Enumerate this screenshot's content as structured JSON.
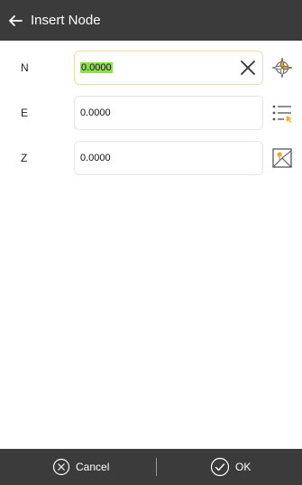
{
  "header": {
    "title": "Insert Node",
    "back_icon": "arrow-left-icon"
  },
  "fields": [
    {
      "label": "N",
      "value": "0.0000",
      "side_icon": "compass-target-icon"
    },
    {
      "label": "E",
      "value": "0.0000",
      "side_icon": "point-list-icon"
    },
    {
      "label": "Z",
      "value": "0.0000",
      "side_icon": "map-pick-icon"
    }
  ],
  "footer": {
    "cancel_label": "Cancel",
    "ok_label": "OK"
  },
  "colors": {
    "header_bg": "#3b3b3b",
    "selection_highlight": "#8fe04f",
    "active_border": "#f3dba6",
    "icon_accent": "#f5a623"
  }
}
